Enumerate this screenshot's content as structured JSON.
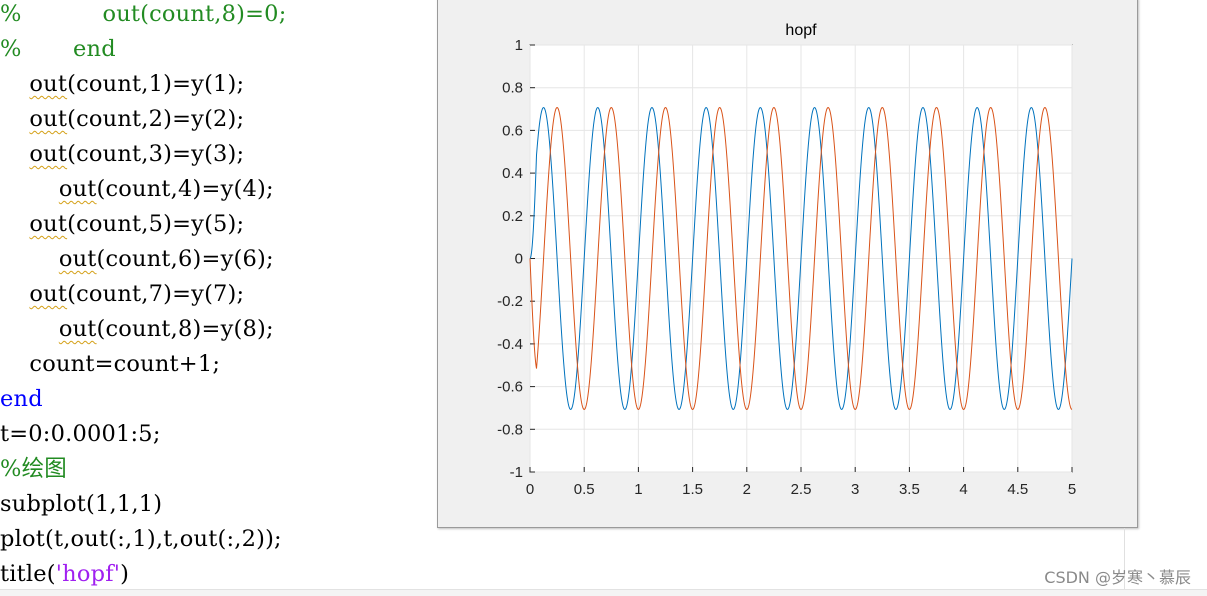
{
  "editor": {
    "lines": [
      {
        "segments": [
          {
            "t": "%           out(count,8)=0;",
            "c": "green"
          }
        ]
      },
      {
        "segments": [
          {
            "t": "%       end",
            "c": "green"
          }
        ]
      },
      {
        "segments": [
          {
            "t": "    "
          },
          {
            "t": "out",
            "c": "squig"
          },
          {
            "t": "(count,1)=y(1);"
          }
        ]
      },
      {
        "segments": [
          {
            "t": "    "
          },
          {
            "t": "out",
            "c": "squig"
          },
          {
            "t": "(count,2)=y(2);"
          }
        ]
      },
      {
        "segments": [
          {
            "t": "    "
          },
          {
            "t": "out",
            "c": "squig"
          },
          {
            "t": "(count,3)=y(3);"
          }
        ]
      },
      {
        "segments": [
          {
            "t": "        "
          },
          {
            "t": "out",
            "c": "squig"
          },
          {
            "t": "(count,4)=y(4);"
          }
        ]
      },
      {
        "segments": [
          {
            "t": "    "
          },
          {
            "t": "out",
            "c": "squig"
          },
          {
            "t": "(count,5)=y(5);"
          }
        ]
      },
      {
        "segments": [
          {
            "t": "        "
          },
          {
            "t": "out",
            "c": "squig"
          },
          {
            "t": "(count,6)=y(6);"
          }
        ]
      },
      {
        "segments": [
          {
            "t": "    "
          },
          {
            "t": "out",
            "c": "squig"
          },
          {
            "t": "(count,7)=y(7);"
          }
        ]
      },
      {
        "segments": [
          {
            "t": "        "
          },
          {
            "t": "out",
            "c": "squig"
          },
          {
            "t": "(count,8)=y(8);"
          }
        ]
      },
      {
        "segments": [
          {
            "t": "    count=count+1;"
          }
        ]
      },
      {
        "segments": [
          {
            "t": "end",
            "c": "blue"
          }
        ]
      },
      {
        "segments": [
          {
            "t": "t=0:0.0001:5;"
          }
        ]
      },
      {
        "segments": [
          {
            "t": "%绘图",
            "c": "green"
          }
        ]
      },
      {
        "segments": [
          {
            "t": "subplot(1,1,1)"
          }
        ]
      },
      {
        "segments": [
          {
            "t": "plot(t,out(:,1),t,out(:,2));"
          }
        ]
      },
      {
        "segments": [
          {
            "t": "title("
          },
          {
            "t": "'hopf'",
            "c": "purple"
          },
          {
            "t": ")"
          }
        ]
      }
    ]
  },
  "figure": {
    "background": "#f0f0f0"
  },
  "chart_data": {
    "type": "line",
    "title": "hopf",
    "xlabel": "",
    "ylabel": "",
    "xlim": [
      0,
      5
    ],
    "ylim": [
      -1,
      1
    ],
    "xticks": [
      "0",
      "0.5",
      "1",
      "1.5",
      "2",
      "2.5",
      "3",
      "3.5",
      "4",
      "4.5",
      "5"
    ],
    "yticks": [
      "1",
      "0.8",
      "0.6",
      "0.4",
      "0.2",
      "0",
      "-0.2",
      "-0.4",
      "-0.6",
      "-0.8",
      "-1"
    ],
    "grid": true,
    "series": [
      {
        "color": "#0072bd",
        "amplitude": 0.707,
        "frequency_hz": 2,
        "start_value": 0.0,
        "note_shape": "sin"
      },
      {
        "color": "#d95319",
        "amplitude": 0.707,
        "frequency_hz": 2,
        "start_value": 0.0,
        "note_shape": "neg-cos"
      }
    ]
  },
  "watermark": "CSDN @岁寒丶慕辰"
}
